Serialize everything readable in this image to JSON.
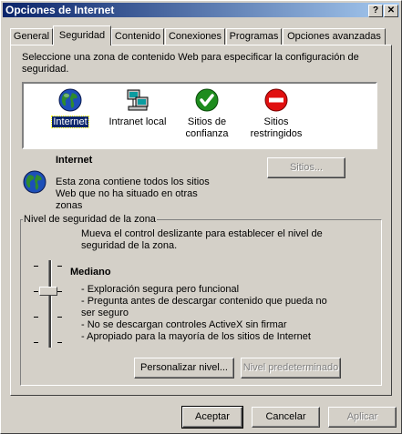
{
  "window": {
    "title": "Opciones de Internet",
    "help_button": "?",
    "close_button": "✕"
  },
  "tabs": [
    {
      "label": "General"
    },
    {
      "label": "Seguridad",
      "active": true
    },
    {
      "label": "Contenido"
    },
    {
      "label": "Conexiones"
    },
    {
      "label": "Programas"
    },
    {
      "label": "Opciones avanzadas"
    }
  ],
  "security": {
    "instruction_line1": "Seleccione una zona de contenido Web para especificar la configuración de",
    "instruction_line2": "seguridad.",
    "zones": [
      {
        "icon": "globe-icon",
        "line1": "Internet",
        "line2": "",
        "selected": true
      },
      {
        "icon": "intranet-computer-icon",
        "line1": "Intranet local",
        "line2": ""
      },
      {
        "icon": "trusted-check-icon",
        "line1": "Sitios de",
        "line2": "confianza"
      },
      {
        "icon": "restricted-no-entry-icon",
        "line1": "Sitios",
        "line2": "restringidos"
      }
    ],
    "selected_zone_title": "Internet",
    "zone_desc_line1": "Esta zona contiene todos los sitios",
    "zone_desc_line2": "Web que no ha situado en otras",
    "zone_desc_line3": "zonas",
    "sites_button": "Sitios...",
    "level_group_label": "Nivel de seguridad de la zona",
    "level_instr_line1": "Mueva el control deslizante para establecer el nivel de",
    "level_instr_line2": "seguridad de la zona.",
    "level_name": "Mediano",
    "level_desc": [
      "- Exploración segura pero funcional",
      "- Pregunta antes de descargar contenido que pueda no",
      "ser seguro",
      "- No se descargan controles ActiveX sin firmar",
      "- Apropiado para la mayoría de los sitios de Internet"
    ],
    "custom_level_button": "Personalizar nivel...",
    "default_level_button": "Nivel predeterminado"
  },
  "footer": {
    "ok": "Aceptar",
    "cancel": "Cancelar",
    "apply": "Aplicar"
  },
  "colors": {
    "titlebar_start": "#0a246a",
    "titlebar_end": "#a6caf0",
    "face": "#d4d0c8",
    "selection": "#0a246a"
  }
}
